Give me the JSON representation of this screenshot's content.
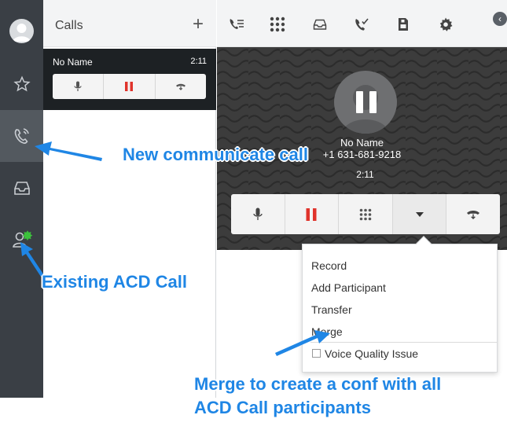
{
  "colors": {
    "rail": "#3a3f45",
    "accent_blue": "#1f86e5",
    "hold_red": "#e0332b",
    "presence_green": "#3cc23c"
  },
  "calls_panel": {
    "title": "Calls",
    "add_label": "+",
    "active_call": {
      "name": "No Name",
      "duration": "2:11"
    }
  },
  "rail_icons": [
    "avatar",
    "star-icon",
    "calls-icon",
    "inbox-icon",
    "acd-agent-icon"
  ],
  "toolbar_icons": [
    "call-list-icon",
    "dialpad-icon",
    "inbox-icon",
    "call-history-icon",
    "voicemail-icon",
    "settings-icon"
  ],
  "call_pane": {
    "name": "No Name",
    "number": "+1 631-681-9218",
    "timer": "2:11"
  },
  "menu": {
    "items": [
      "Record",
      "Add Participant",
      "Transfer",
      "Merge"
    ],
    "checkbox_label": "Voice Quality Issue"
  },
  "annotations": {
    "new_call": "New communicate call",
    "existing_acd": "Existing ACD Call",
    "merge_line1": "Merge to create a conf with all",
    "merge_line2": "ACD Call participants"
  }
}
